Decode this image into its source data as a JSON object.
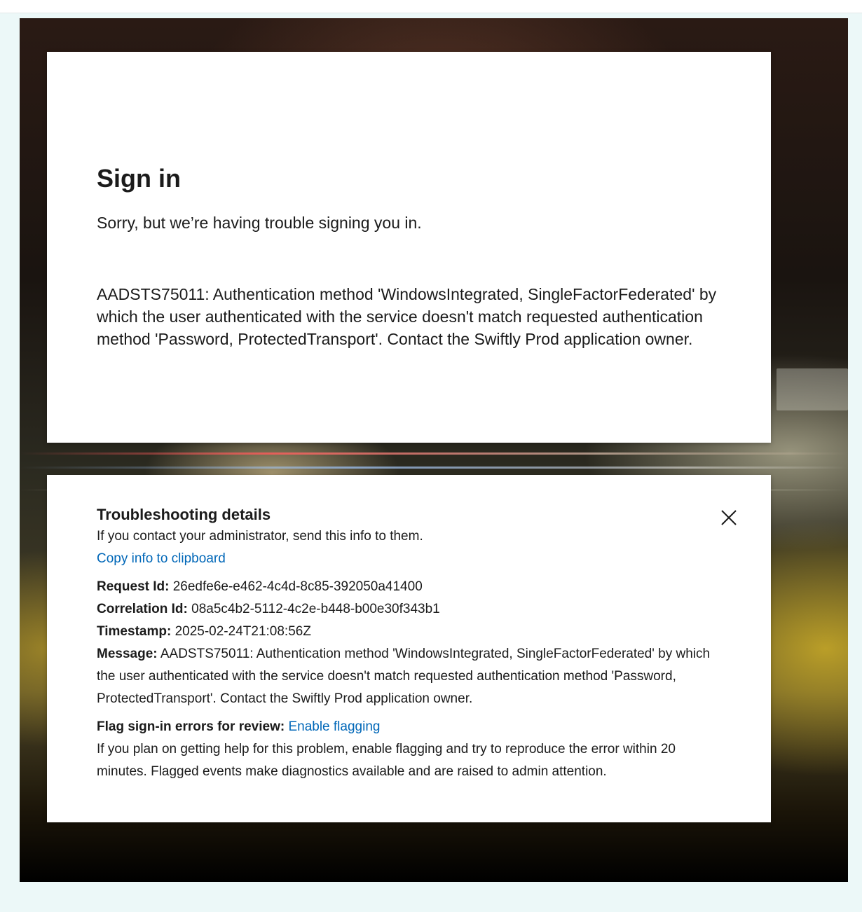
{
  "signin": {
    "title": "Sign in",
    "subtitle": "Sorry, but we’re having trouble signing you in.",
    "error_message": "AADSTS75011: Authentication method 'WindowsIntegrated, SingleFactorFederated' by which the user authenticated with the service doesn't match requested authentication method 'Password, ProtectedTransport'. Contact the Swiftly Prod application owner."
  },
  "troubleshooting": {
    "title": "Troubleshooting details",
    "instruction": "If you contact your administrator, send this info to them.",
    "copy_link": "Copy info to clipboard",
    "request_id_label": "Request Id:",
    "request_id": "26edfe6e-e462-4c4d-8c85-392050a41400",
    "correlation_id_label": "Correlation Id:",
    "correlation_id": "08a5c4b2-5112-4c2e-b448-b00e30f343b1",
    "timestamp_label": "Timestamp:",
    "timestamp": "2025-02-24T21:08:56Z",
    "message_label": "Message:",
    "message": "AADSTS75011: Authentication method 'WindowsIntegrated, SingleFactorFederated' by which the user authenticated with the service doesn't match requested authentication method 'Password, ProtectedTransport'. Contact the Swiftly Prod application owner.",
    "flag_label": "Flag sign-in errors for review:",
    "flag_link": "Enable flagging",
    "flag_description": "If you plan on getting help for this problem, enable flagging and try to reproduce the error within 20 minutes. Flagged events make diagnostics available and are raised to admin attention.",
    "close_icon": "close-icon"
  },
  "colors": {
    "link": "#0067b8",
    "page_background": "#ecf8f8",
    "card_background": "#ffffff"
  }
}
